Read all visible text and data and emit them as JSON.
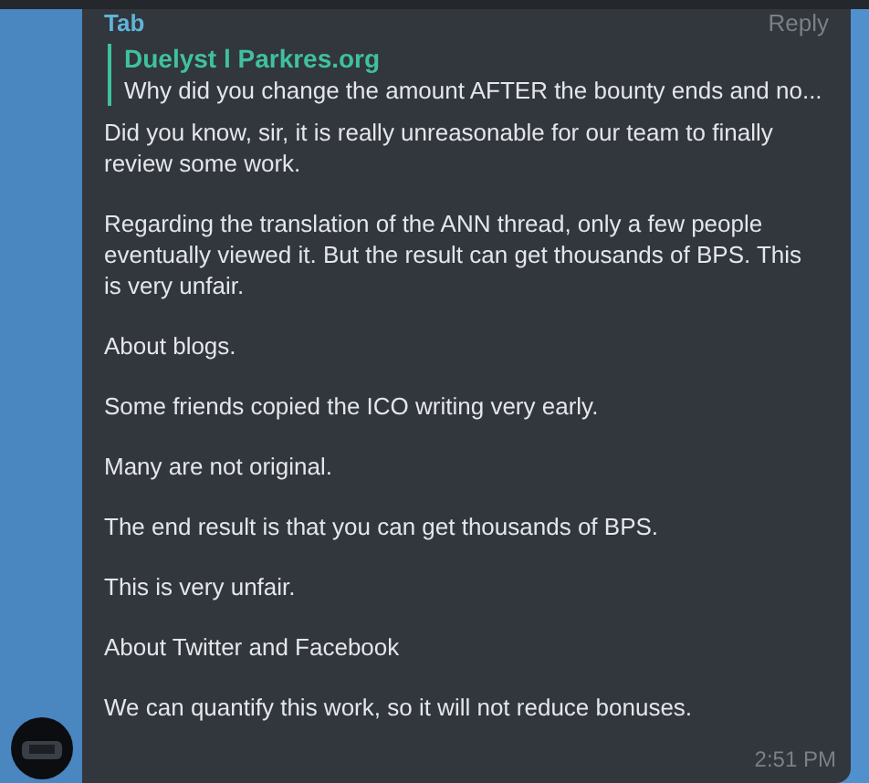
{
  "message": {
    "sender": "Tab",
    "reply_action": "Reply",
    "quote": {
      "author": "Duelyst l Parkres.org",
      "text": "Why did you change the amount AFTER the bounty ends and no..."
    },
    "paragraphs": [
      "Did you know, sir, it is really unreasonable for our team to finally review some work.",
      "Regarding the translation of the ANN thread, only a few people eventually viewed it. But the result can get thousands of BPS. This is very unfair.",
      "About blogs.",
      "Some friends copied the ICO writing very early.",
      "Many are not original.",
      "The end result is that you can get thousands of BPS.",
      "This is very unfair.",
      "About Twitter and Facebook",
      "We can quantify this work, so it will not reduce bonuses."
    ],
    "time": "2:51 PM"
  }
}
